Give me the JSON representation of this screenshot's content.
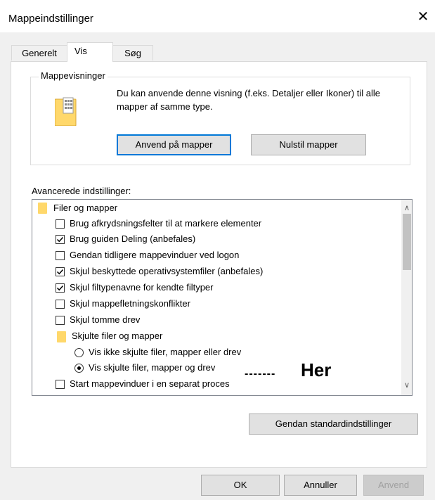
{
  "window": {
    "title": "Mappeindstillinger"
  },
  "tabs": [
    {
      "label": "Generelt"
    },
    {
      "label": "Vis"
    },
    {
      "label": "Søg"
    }
  ],
  "folder_views": {
    "legend": "Mappevisninger",
    "description": "Du kan anvende denne visning (f.eks. Detaljer eller Ikoner) til alle mapper af samme type.",
    "apply_button": "Anvend på mapper",
    "reset_button": "Nulstil mapper"
  },
  "advanced": {
    "label": "Avancerede indstillinger:",
    "items": [
      {
        "type": "folder",
        "label": "Filer og mapper"
      },
      {
        "type": "checkbox",
        "checked": false,
        "label": "Brug afkrydsningsfelter til at markere elementer"
      },
      {
        "type": "checkbox",
        "checked": true,
        "label": "Brug guiden Deling (anbefales)"
      },
      {
        "type": "checkbox",
        "checked": false,
        "label": "Gendan tidligere mappevinduer ved logon"
      },
      {
        "type": "checkbox",
        "checked": true,
        "label": "Skjul beskyttede operativsystemfiler (anbefales)"
      },
      {
        "type": "checkbox",
        "checked": true,
        "label": "Skjul filtypenavne for kendte filtyper"
      },
      {
        "type": "checkbox",
        "checked": false,
        "label": "Skjul mappefletningskonflikter"
      },
      {
        "type": "checkbox",
        "checked": false,
        "label": "Skjul tomme drev"
      },
      {
        "type": "folder",
        "label": "Skjulte filer og mapper"
      },
      {
        "type": "radio",
        "checked": false,
        "label": "Vis ikke skjulte filer, mapper eller drev"
      },
      {
        "type": "radio",
        "checked": true,
        "label": "Vis skjulte filer, mapper og drev"
      },
      {
        "type": "checkbox",
        "checked": false,
        "label": "Start mappevinduer i en separat proces"
      }
    ],
    "restore_button": "Gendan standardindstillinger"
  },
  "annotation": {
    "dashes": "-------",
    "text": "Her"
  },
  "footer": {
    "ok": "OK",
    "cancel": "Annuller",
    "apply": "Anvend"
  },
  "colors": {
    "accent": "#0078d7",
    "folder": "#ffd86b"
  }
}
